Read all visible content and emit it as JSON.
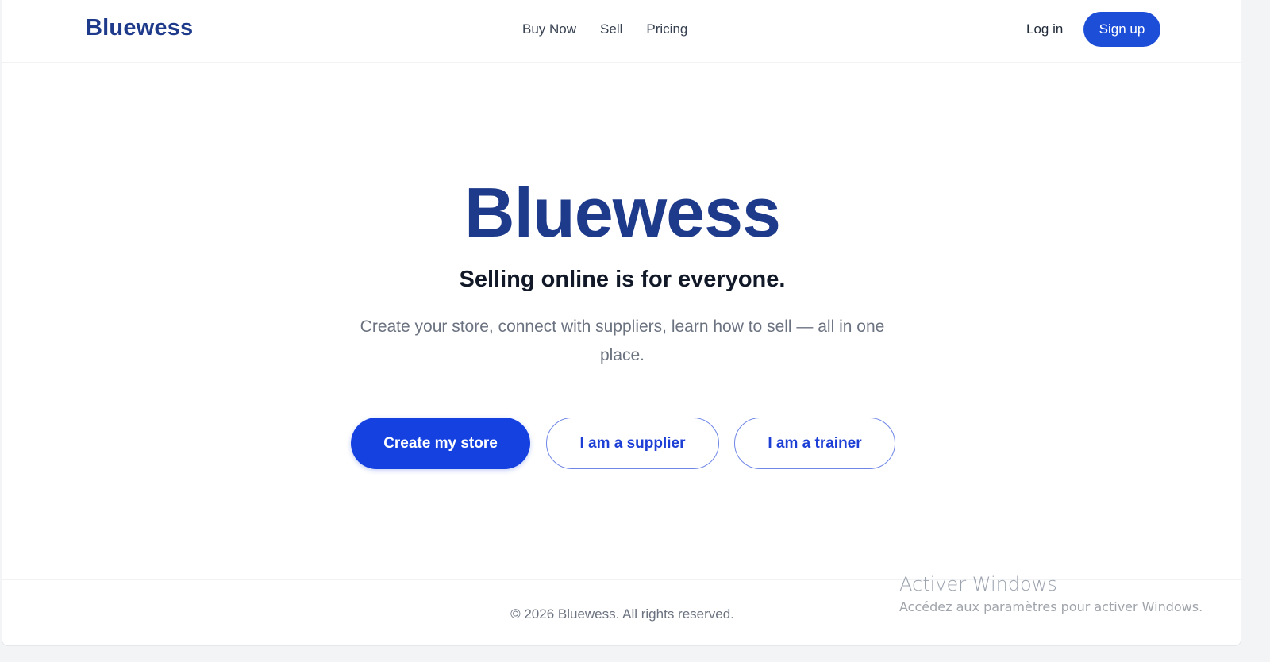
{
  "header": {
    "brand": "Bluewess",
    "nav": [
      "Buy Now",
      "Sell",
      "Pricing"
    ],
    "login_label": "Log in",
    "signup_label": "Sign up"
  },
  "hero": {
    "title": "Bluewess",
    "subtitle": "Selling online is for everyone.",
    "description": "Create your store, connect with suppliers, learn how to sell — all in one place.",
    "cta_primary": "Create my store",
    "cta_supplier": "I am a supplier",
    "cta_trainer": "I am a trainer"
  },
  "footer": {
    "copyright": "© 2026 Bluewess. All rights reserved."
  },
  "watermark": {
    "title": "Activer Windows",
    "subtitle": "Accédez aux paramètres pour activer Windows."
  },
  "colors": {
    "brand": "#1e3a8a",
    "primary": "#1441e0",
    "text_muted": "#6b7280"
  }
}
